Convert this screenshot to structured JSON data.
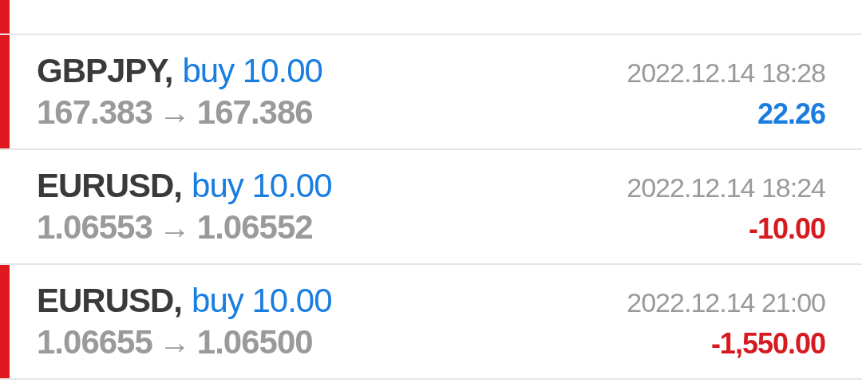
{
  "top_row": {
    "marked": true
  },
  "deals": [
    {
      "symbol": "GBPJPY,",
      "type": "buy 10.00",
      "time": "2022.12.14 18:28",
      "open_price": "167.383",
      "arrow": "→",
      "close_price": "167.386",
      "profit": "22.26",
      "color": "#1a7de0",
      "marked": true
    },
    {
      "symbol": "EURUSD,",
      "type": "buy 10.00",
      "time": "2022.12.14 18:24",
      "open_price": "1.06553",
      "arrow": "→",
      "close_price": "1.06552",
      "profit": "-10.00",
      "color": "#d61a1f",
      "marked": false
    },
    {
      "symbol": "EURUSD,",
      "type": "buy 10.00",
      "time": "2022.12.14 21:00",
      "open_price": "1.06655",
      "arrow": "→",
      "close_price": "1.06500",
      "profit": "-1,550.00",
      "color": "#d61a1f",
      "marked": true
    }
  ]
}
